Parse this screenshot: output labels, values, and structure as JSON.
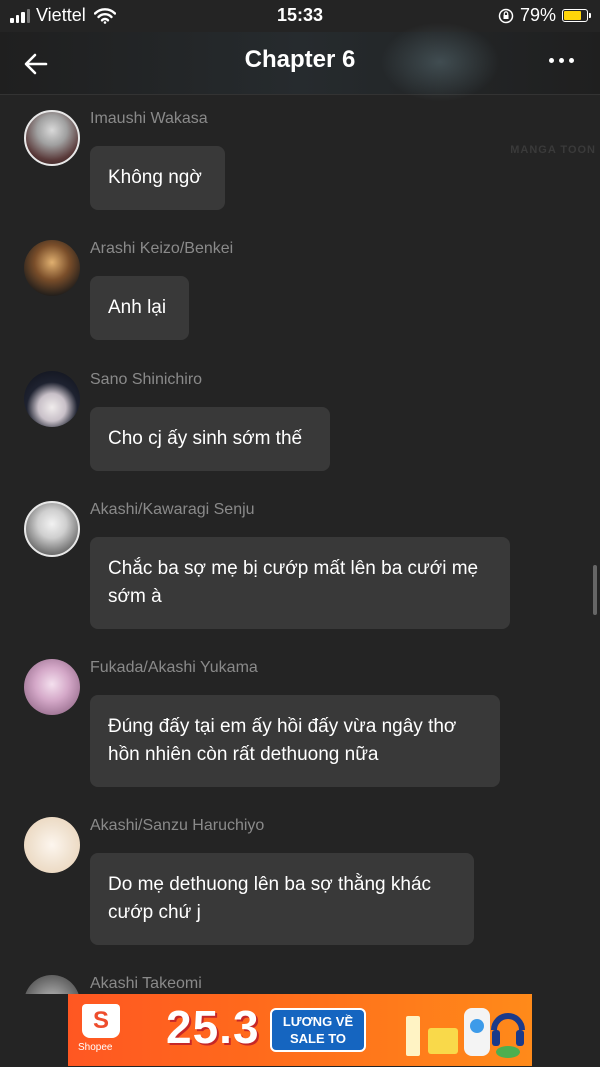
{
  "status_bar": {
    "carrier": "Viettel",
    "time": "15:33",
    "battery": "79%",
    "battery_level": 0.79
  },
  "header": {
    "title": "Chapter 6"
  },
  "watermark": "MANGA TOON",
  "messages": [
    {
      "user": "Imaushi Wakasa",
      "text": "Không ngờ"
    },
    {
      "user": "Arashi Keizo/Benkei",
      "text": "Anh lại"
    },
    {
      "user": "Sano Shinichiro",
      "text": "Cho cj ấy sinh sớm thế"
    },
    {
      "user": "Akashi/Kawaragi Senju",
      "text": "Chắc ba sợ mẹ bị cướp mất lên ba cưới mẹ sớm à"
    },
    {
      "user": "Fukada/Akashi Yukama",
      "text": "Đúng đấy tại em ấy hồi đấy vừa ngây thơ hồn nhiên còn rất dethuong nữa"
    },
    {
      "user": "Akashi/Sanzu Haruchiyo",
      "text": "Do mẹ dethuong lên ba sợ thằng khác cướp chứ j"
    },
    {
      "user": "Akashi Takeomi",
      "text": ""
    }
  ],
  "ad": {
    "brand": "Shopee",
    "headline": "25.3",
    "badge_line1": "LƯƠNG VỀ",
    "badge_line2": "SALE TO"
  },
  "colors": {
    "background": "#242424",
    "bubble": "#393939",
    "username": "#8a8a8a",
    "battery": "#ffd60a",
    "ad_orange": "#ff5722",
    "ad_badge": "#1565c0"
  }
}
